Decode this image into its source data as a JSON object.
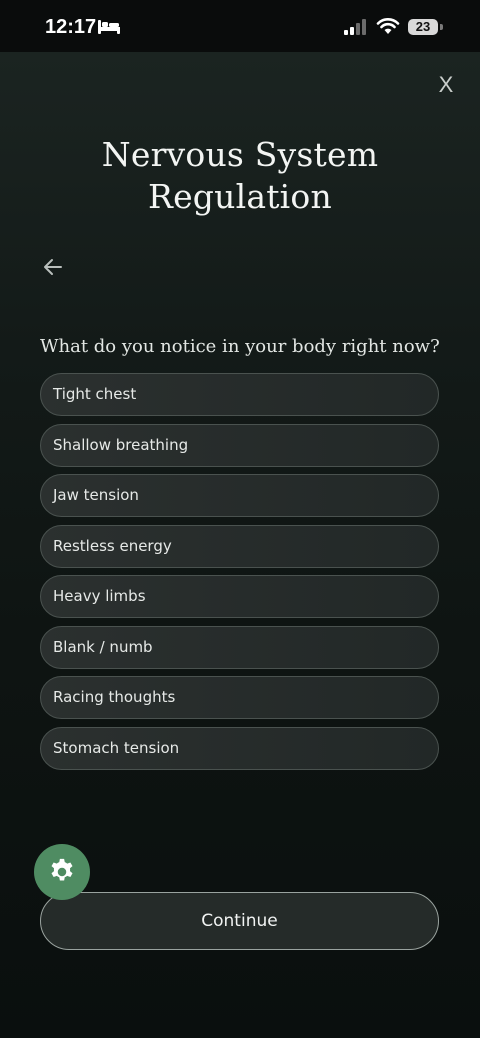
{
  "status_bar": {
    "time": "12:17",
    "battery": "23",
    "icons": [
      "bed-icon",
      "signal-icon",
      "wifi-icon",
      "battery-icon"
    ]
  },
  "header": {
    "close_label": "X",
    "title": "Nervous System Regulation"
  },
  "question": "What do you notice in your body right now?",
  "options": [
    "Tight chest",
    "Shallow breathing",
    "Jaw tension",
    "Restless energy",
    "Heavy limbs",
    "Blank / numb",
    "Racing thoughts",
    "Stomach tension"
  ],
  "continue_label": "Continue",
  "colors": {
    "background": "#0b1110",
    "accent_green": "#4f8c62",
    "option_border": "#4a524f"
  }
}
